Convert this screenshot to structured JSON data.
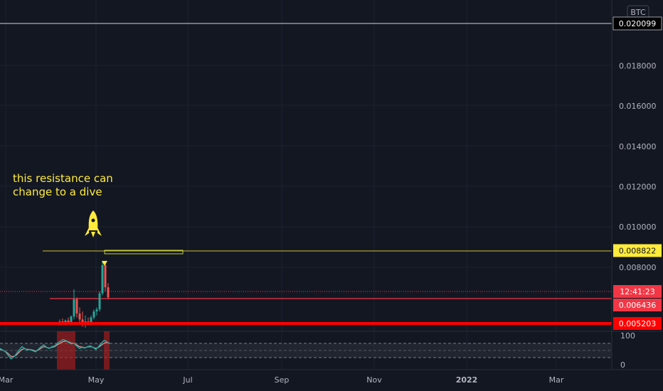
{
  "chart_data": {
    "type": "candlestick",
    "currency_label": "BTC",
    "ylim": [
      0.0045,
      0.0207
    ],
    "y_ticks": [
      "0.018000",
      "0.016000",
      "0.014000",
      "0.012000",
      "0.010000",
      "0.008000"
    ],
    "x_ticks": [
      "Mar",
      "May",
      "Jul",
      "Sep",
      "Nov",
      "2022",
      "Mar"
    ],
    "price_tags": [
      {
        "id": "top-line",
        "label": "0.020099",
        "value": 0.020099,
        "bg": "#000000",
        "fg": "#ffffff",
        "border": "#ffffff"
      },
      {
        "id": "resistance",
        "label": "0.008822",
        "value": 0.008822,
        "bg": "#ffeb3b",
        "fg": "#131722"
      },
      {
        "id": "countdown",
        "label": "12:41:23",
        "value": 0.006883,
        "bg": "#f23645",
        "fg": "#ffffff"
      },
      {
        "id": "current-price",
        "label": "0.006436",
        "value": 0.006436,
        "bg": "#f23645",
        "fg": "#ffffff"
      },
      {
        "id": "support",
        "label": "0.005203",
        "value": 0.005203,
        "bg": "#ff0000",
        "fg": "#ffffff"
      }
    ],
    "candles": [
      {
        "x": 84,
        "o": 0.00525,
        "h": 0.0054,
        "l": 0.0051,
        "c": 0.0053
      },
      {
        "x": 88,
        "o": 0.0053,
        "h": 0.00545,
        "l": 0.00515,
        "c": 0.0052
      },
      {
        "x": 92,
        "o": 0.0052,
        "h": 0.0054,
        "l": 0.0051,
        "c": 0.00535
      },
      {
        "x": 96,
        "o": 0.00535,
        "h": 0.0055,
        "l": 0.0052,
        "c": 0.00525
      },
      {
        "x": 100,
        "o": 0.00525,
        "h": 0.0056,
        "l": 0.0052,
        "c": 0.00555
      },
      {
        "x": 104,
        "o": 0.00555,
        "h": 0.0069,
        "l": 0.0054,
        "c": 0.0064
      },
      {
        "x": 108,
        "o": 0.0064,
        "h": 0.0065,
        "l": 0.0055,
        "c": 0.0057
      },
      {
        "x": 112,
        "o": 0.0057,
        "h": 0.006,
        "l": 0.0052,
        "c": 0.0054
      },
      {
        "x": 116,
        "o": 0.0054,
        "h": 0.0058,
        "l": 0.00505,
        "c": 0.0052
      },
      {
        "x": 120,
        "o": 0.0052,
        "h": 0.0056,
        "l": 0.005,
        "c": 0.0053
      },
      {
        "x": 124,
        "o": 0.0053,
        "h": 0.0055,
        "l": 0.0051,
        "c": 0.00515
      },
      {
        "x": 128,
        "o": 0.00515,
        "h": 0.0056,
        "l": 0.0051,
        "c": 0.0055
      },
      {
        "x": 132,
        "o": 0.0055,
        "h": 0.0059,
        "l": 0.0054,
        "c": 0.0058
      },
      {
        "x": 136,
        "o": 0.0058,
        "h": 0.006,
        "l": 0.0056,
        "c": 0.0059
      },
      {
        "x": 140,
        "o": 0.0059,
        "h": 0.0068,
        "l": 0.0058,
        "c": 0.0067
      },
      {
        "x": 144,
        "o": 0.0067,
        "h": 0.0083,
        "l": 0.0066,
        "c": 0.0081
      },
      {
        "x": 148,
        "o": 0.0081,
        "h": 0.0082,
        "l": 0.0068,
        "c": 0.007
      },
      {
        "x": 152,
        "o": 0.007,
        "h": 0.0072,
        "l": 0.0064,
        "c": 0.0065
      }
    ],
    "annotation": {
      "line1": "this resistance can",
      "line2": "change to a dive",
      "icon": "rocket-icon"
    },
    "oscillator": {
      "y_ticks": [
        "100",
        "0"
      ],
      "values": [
        55,
        50,
        45,
        35,
        25,
        30,
        40,
        50,
        60,
        55,
        50,
        52,
        48,
        45,
        52,
        60,
        65,
        58,
        55,
        60,
        62,
        70,
        75,
        80,
        78,
        72,
        68,
        70,
        62,
        55,
        58,
        56,
        60,
        62,
        58,
        52,
        60,
        70,
        78,
        74,
        68
      ],
      "signal": [
        52,
        50,
        46,
        40,
        32,
        32,
        36,
        44,
        52,
        54,
        52,
        52,
        50,
        47,
        50,
        56,
        60,
        58,
        56,
        58,
        60,
        66,
        70,
        74,
        76,
        74,
        70,
        70,
        65,
        60,
        59,
        57,
        59,
        60,
        58,
        55,
        58,
        64,
        70,
        72,
        70
      ]
    },
    "colors": {
      "background": "#131722",
      "up": "#26a69a",
      "down": "#ef5350",
      "resistance": "#ffeb3b",
      "support": "#ff0000",
      "current": "#f23645",
      "oscillator_line": "#26a69a",
      "oscillator_signal": "#ef9a9a"
    }
  }
}
